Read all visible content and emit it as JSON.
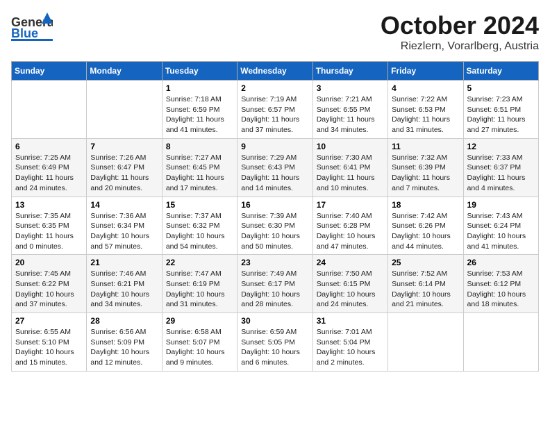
{
  "header": {
    "logo_general": "General",
    "logo_blue": "Blue",
    "month": "October 2024",
    "location": "Riezlern, Vorarlberg, Austria"
  },
  "weekdays": [
    "Sunday",
    "Monday",
    "Tuesday",
    "Wednesday",
    "Thursday",
    "Friday",
    "Saturday"
  ],
  "weeks": [
    [
      {
        "day": "",
        "sunrise": "",
        "sunset": "",
        "daylight": ""
      },
      {
        "day": "",
        "sunrise": "",
        "sunset": "",
        "daylight": ""
      },
      {
        "day": "1",
        "sunrise": "Sunrise: 7:18 AM",
        "sunset": "Sunset: 6:59 PM",
        "daylight": "Daylight: 11 hours and 41 minutes."
      },
      {
        "day": "2",
        "sunrise": "Sunrise: 7:19 AM",
        "sunset": "Sunset: 6:57 PM",
        "daylight": "Daylight: 11 hours and 37 minutes."
      },
      {
        "day": "3",
        "sunrise": "Sunrise: 7:21 AM",
        "sunset": "Sunset: 6:55 PM",
        "daylight": "Daylight: 11 hours and 34 minutes."
      },
      {
        "day": "4",
        "sunrise": "Sunrise: 7:22 AM",
        "sunset": "Sunset: 6:53 PM",
        "daylight": "Daylight: 11 hours and 31 minutes."
      },
      {
        "day": "5",
        "sunrise": "Sunrise: 7:23 AM",
        "sunset": "Sunset: 6:51 PM",
        "daylight": "Daylight: 11 hours and 27 minutes."
      }
    ],
    [
      {
        "day": "6",
        "sunrise": "Sunrise: 7:25 AM",
        "sunset": "Sunset: 6:49 PM",
        "daylight": "Daylight: 11 hours and 24 minutes."
      },
      {
        "day": "7",
        "sunrise": "Sunrise: 7:26 AM",
        "sunset": "Sunset: 6:47 PM",
        "daylight": "Daylight: 11 hours and 20 minutes."
      },
      {
        "day": "8",
        "sunrise": "Sunrise: 7:27 AM",
        "sunset": "Sunset: 6:45 PM",
        "daylight": "Daylight: 11 hours and 17 minutes."
      },
      {
        "day": "9",
        "sunrise": "Sunrise: 7:29 AM",
        "sunset": "Sunset: 6:43 PM",
        "daylight": "Daylight: 11 hours and 14 minutes."
      },
      {
        "day": "10",
        "sunrise": "Sunrise: 7:30 AM",
        "sunset": "Sunset: 6:41 PM",
        "daylight": "Daylight: 11 hours and 10 minutes."
      },
      {
        "day": "11",
        "sunrise": "Sunrise: 7:32 AM",
        "sunset": "Sunset: 6:39 PM",
        "daylight": "Daylight: 11 hours and 7 minutes."
      },
      {
        "day": "12",
        "sunrise": "Sunrise: 7:33 AM",
        "sunset": "Sunset: 6:37 PM",
        "daylight": "Daylight: 11 hours and 4 minutes."
      }
    ],
    [
      {
        "day": "13",
        "sunrise": "Sunrise: 7:35 AM",
        "sunset": "Sunset: 6:35 PM",
        "daylight": "Daylight: 11 hours and 0 minutes."
      },
      {
        "day": "14",
        "sunrise": "Sunrise: 7:36 AM",
        "sunset": "Sunset: 6:34 PM",
        "daylight": "Daylight: 10 hours and 57 minutes."
      },
      {
        "day": "15",
        "sunrise": "Sunrise: 7:37 AM",
        "sunset": "Sunset: 6:32 PM",
        "daylight": "Daylight: 10 hours and 54 minutes."
      },
      {
        "day": "16",
        "sunrise": "Sunrise: 7:39 AM",
        "sunset": "Sunset: 6:30 PM",
        "daylight": "Daylight: 10 hours and 50 minutes."
      },
      {
        "day": "17",
        "sunrise": "Sunrise: 7:40 AM",
        "sunset": "Sunset: 6:28 PM",
        "daylight": "Daylight: 10 hours and 47 minutes."
      },
      {
        "day": "18",
        "sunrise": "Sunrise: 7:42 AM",
        "sunset": "Sunset: 6:26 PM",
        "daylight": "Daylight: 10 hours and 44 minutes."
      },
      {
        "day": "19",
        "sunrise": "Sunrise: 7:43 AM",
        "sunset": "Sunset: 6:24 PM",
        "daylight": "Daylight: 10 hours and 41 minutes."
      }
    ],
    [
      {
        "day": "20",
        "sunrise": "Sunrise: 7:45 AM",
        "sunset": "Sunset: 6:22 PM",
        "daylight": "Daylight: 10 hours and 37 minutes."
      },
      {
        "day": "21",
        "sunrise": "Sunrise: 7:46 AM",
        "sunset": "Sunset: 6:21 PM",
        "daylight": "Daylight: 10 hours and 34 minutes."
      },
      {
        "day": "22",
        "sunrise": "Sunrise: 7:47 AM",
        "sunset": "Sunset: 6:19 PM",
        "daylight": "Daylight: 10 hours and 31 minutes."
      },
      {
        "day": "23",
        "sunrise": "Sunrise: 7:49 AM",
        "sunset": "Sunset: 6:17 PM",
        "daylight": "Daylight: 10 hours and 28 minutes."
      },
      {
        "day": "24",
        "sunrise": "Sunrise: 7:50 AM",
        "sunset": "Sunset: 6:15 PM",
        "daylight": "Daylight: 10 hours and 24 minutes."
      },
      {
        "day": "25",
        "sunrise": "Sunrise: 7:52 AM",
        "sunset": "Sunset: 6:14 PM",
        "daylight": "Daylight: 10 hours and 21 minutes."
      },
      {
        "day": "26",
        "sunrise": "Sunrise: 7:53 AM",
        "sunset": "Sunset: 6:12 PM",
        "daylight": "Daylight: 10 hours and 18 minutes."
      }
    ],
    [
      {
        "day": "27",
        "sunrise": "Sunrise: 6:55 AM",
        "sunset": "Sunset: 5:10 PM",
        "daylight": "Daylight: 10 hours and 15 minutes."
      },
      {
        "day": "28",
        "sunrise": "Sunrise: 6:56 AM",
        "sunset": "Sunset: 5:09 PM",
        "daylight": "Daylight: 10 hours and 12 minutes."
      },
      {
        "day": "29",
        "sunrise": "Sunrise: 6:58 AM",
        "sunset": "Sunset: 5:07 PM",
        "daylight": "Daylight: 10 hours and 9 minutes."
      },
      {
        "day": "30",
        "sunrise": "Sunrise: 6:59 AM",
        "sunset": "Sunset: 5:05 PM",
        "daylight": "Daylight: 10 hours and 6 minutes."
      },
      {
        "day": "31",
        "sunrise": "Sunrise: 7:01 AM",
        "sunset": "Sunset: 5:04 PM",
        "daylight": "Daylight: 10 hours and 2 minutes."
      },
      {
        "day": "",
        "sunrise": "",
        "sunset": "",
        "daylight": ""
      },
      {
        "day": "",
        "sunrise": "",
        "sunset": "",
        "daylight": ""
      }
    ]
  ]
}
